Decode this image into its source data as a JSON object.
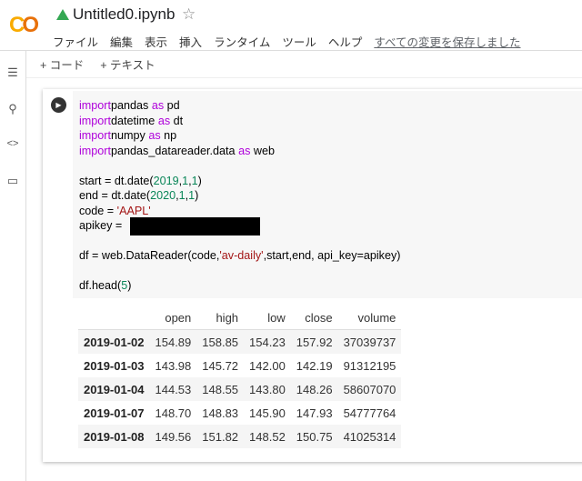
{
  "header": {
    "logo": "CO",
    "title": "Untitled0.ipynb",
    "menu": [
      "ファイル",
      "編集",
      "表示",
      "挿入",
      "ランタイム",
      "ツール",
      "ヘルプ"
    ],
    "saved_status": "すべての変更を保存しました"
  },
  "toolbar": {
    "add_code": "+ コード",
    "add_text": "+ テキスト"
  },
  "sidebar": {
    "icons": [
      "list-icon",
      "search-icon",
      "code-icon",
      "folder-icon"
    ]
  },
  "code_lines": [
    [
      [
        "kw",
        "import"
      ],
      [
        "",
        "pandas "
      ],
      [
        "kw",
        "as"
      ],
      [
        "",
        " pd"
      ]
    ],
    [
      [
        "kw",
        "import"
      ],
      [
        "",
        "datetime "
      ],
      [
        "kw",
        "as"
      ],
      [
        "",
        " dt"
      ]
    ],
    [
      [
        "kw",
        "import"
      ],
      [
        "",
        "numpy "
      ],
      [
        "kw",
        "as"
      ],
      [
        "",
        " np"
      ]
    ],
    [
      [
        "kw",
        "import"
      ],
      [
        "",
        "pandas_datareader.data "
      ],
      [
        "kw",
        "as"
      ],
      [
        "",
        " web"
      ]
    ],
    [],
    [
      [
        "",
        "start = dt.date("
      ],
      [
        "num",
        "2019"
      ],
      [
        "",
        ","
      ],
      [
        "num",
        "1"
      ],
      [
        "",
        ","
      ],
      [
        "num",
        "1"
      ],
      [
        "",
        ")"
      ]
    ],
    [
      [
        "",
        "end = dt.date("
      ],
      [
        "num",
        "2020"
      ],
      [
        "",
        ","
      ],
      [
        "num",
        "1"
      ],
      [
        "",
        ","
      ],
      [
        "num",
        "1"
      ],
      [
        "",
        ")"
      ]
    ],
    [
      [
        "",
        "code = "
      ],
      [
        "str",
        "'AAPL'"
      ]
    ],
    [
      [
        "",
        "apikey = "
      ]
    ],
    [],
    [
      [
        "",
        "df = web.DataReader(code,"
      ],
      [
        "str",
        "'av-daily'"
      ],
      [
        "",
        ",start,end, api_key=apikey)"
      ]
    ],
    [],
    [
      [
        "",
        "df.head("
      ],
      [
        "num",
        "5"
      ],
      [
        "",
        ")"
      ]
    ]
  ],
  "output": {
    "columns": [
      "",
      "open",
      "high",
      "low",
      "close",
      "volume"
    ],
    "rows": [
      [
        "2019-01-02",
        "154.89",
        "158.85",
        "154.23",
        "157.92",
        "37039737"
      ],
      [
        "2019-01-03",
        "143.98",
        "145.72",
        "142.00",
        "142.19",
        "91312195"
      ],
      [
        "2019-01-04",
        "144.53",
        "148.55",
        "143.80",
        "148.26",
        "58607070"
      ],
      [
        "2019-01-07",
        "148.70",
        "148.83",
        "145.90",
        "147.93",
        "54777764"
      ],
      [
        "2019-01-08",
        "149.56",
        "151.82",
        "148.52",
        "150.75",
        "41025314"
      ]
    ]
  }
}
